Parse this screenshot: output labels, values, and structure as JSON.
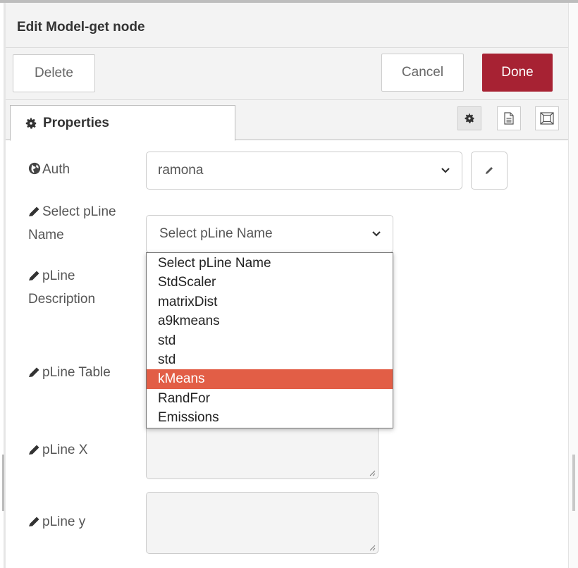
{
  "dialog": {
    "title": "Edit Model-get node",
    "delete_label": "Delete",
    "cancel_label": "Cancel",
    "done_label": "Done",
    "done_color": "#a72233"
  },
  "tabs": {
    "properties_label": "Properties",
    "icons": [
      "gear-icon",
      "document-icon",
      "expand-icon"
    ]
  },
  "form": {
    "auth": {
      "label": "Auth",
      "value": "ramona"
    },
    "select_pline": {
      "label_line1": "Select pLine",
      "label_line2": "Name",
      "value": "Select pLine Name"
    },
    "pline_description": {
      "label_line1": "pLine",
      "label_line2": "Description"
    },
    "pline_table": {
      "label": "pLine Table"
    },
    "pline_x": {
      "label": "pLine X"
    },
    "pline_y": {
      "label": "pLine y"
    }
  },
  "dropdown": {
    "options": [
      "Select pLine Name",
      "StdScaler",
      "matrixDist",
      "a9kmeans",
      "std",
      "std",
      "kMeans",
      "RandFor",
      "Emissions"
    ],
    "highlighted": "kMeans",
    "highlight_color": "#e25e46"
  }
}
